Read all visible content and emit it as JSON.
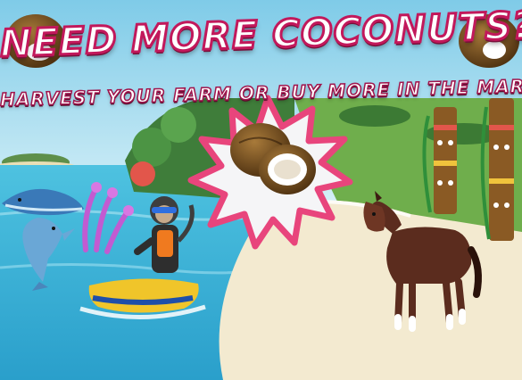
{
  "banner": {
    "title": "NEED MORE COCONUTS?",
    "subtitle": "HARVEST YOUR FARM OR BUY MORE IN THE MARKET!"
  },
  "colors": {
    "title_outline": "#c2185b",
    "burst_pink": "#e8457c",
    "sea": "#3fb7d9",
    "sand": "#f3ead0"
  },
  "icons": [
    "coconut-icon",
    "dolphin-icon",
    "whale-icon",
    "monkey-icon",
    "jet-ski-icon",
    "horse-icon",
    "tiki-totem-icon",
    "coral-icon",
    "island-icon"
  ]
}
